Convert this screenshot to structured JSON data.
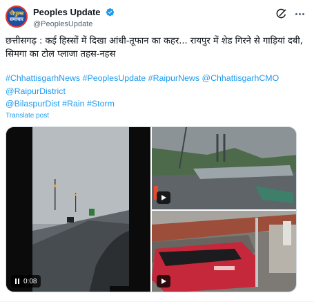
{
  "post": {
    "avatar": {
      "line1": "पीपुल्स",
      "line2": "समाचार"
    },
    "display_name": "Peoples Update",
    "handle": "@PeoplesUpdate",
    "text": "छत्तीसगढ़ : कई हिस्सों में दिखा आंधी-तूफान का कहर... रायपुर में शेड गिरने से गाड़ियां दबी, सिमगा का टोल प्लाजा तहस-नहस",
    "hashtags": [
      "#ChhattisgarhNews",
      "#PeoplesUpdate",
      "#RaipurNews",
      "@ChhattisgarhCMO",
      "@RaipurDistrict",
      "@BilaspurDist",
      "#Rain",
      "#Storm"
    ],
    "translate_label": "Translate post"
  },
  "media": {
    "video1": {
      "duration": "0:08",
      "icon": "pause-icon"
    },
    "video2": {
      "icon": "play-icon"
    },
    "video3": {
      "icon": "play-icon"
    }
  },
  "icons": {
    "verified": "verified-badge-icon",
    "grok": "grok-icon",
    "more": "more-icon"
  },
  "colors": {
    "link": "#1d9bf0",
    "verified": "#1d9bf0",
    "text": "#0f1419",
    "muted": "#536471"
  }
}
